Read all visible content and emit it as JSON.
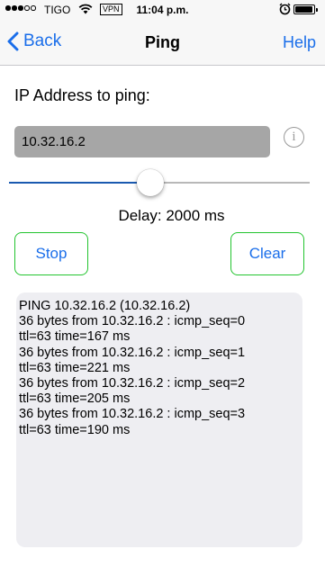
{
  "status_bar": {
    "carrier": "TIGO",
    "vpn": "VPN",
    "time": "11:04 p.m.",
    "signal_filled": 3,
    "signal_total": 5
  },
  "nav": {
    "back_label": "Back",
    "title": "Ping",
    "help_label": "Help"
  },
  "form": {
    "ip_label": "IP Address to ping:",
    "ip_value": "10.32.16.2"
  },
  "slider": {
    "fraction": 0.47
  },
  "delay_label": "Delay: 2000 ms",
  "buttons": {
    "stop": "Stop",
    "clear": "Clear"
  },
  "output": {
    "lines": [
      "PING 10.32.16.2 (10.32.16.2)",
      "36 bytes from 10.32.16.2 : icmp_seq=0",
      "ttl=63 time=167 ms",
      "36 bytes from 10.32.16.2 : icmp_seq=1",
      "ttl=63 time=221 ms",
      "36 bytes from 10.32.16.2 : icmp_seq=2",
      "ttl=63 time=205 ms",
      "36 bytes from 10.32.16.2 : icmp_seq=3",
      "ttl=63 time=190 ms"
    ]
  },
  "colors": {
    "accent": "#1a6eea",
    "button_border": "#22c42e",
    "input_bg": "#a6a6a6",
    "slider_fill": "#1a5ab0"
  }
}
